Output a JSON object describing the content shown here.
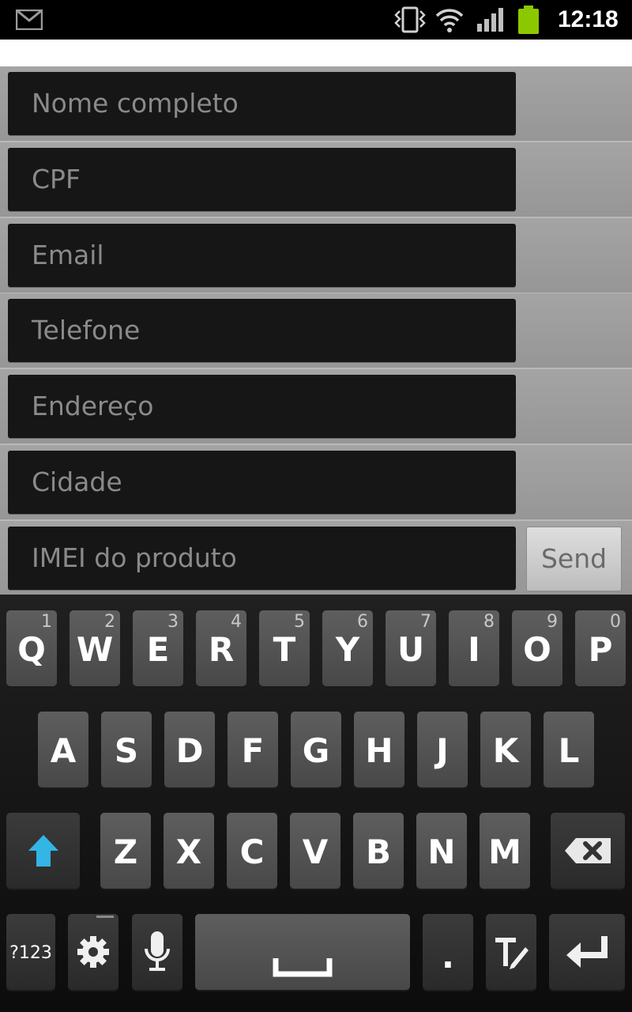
{
  "status_bar": {
    "time": "12:18",
    "icons": [
      "mail-icon",
      "vibrate-icon",
      "wifi-icon",
      "signal-icon",
      "battery-icon"
    ],
    "battery_color": "#8cc800"
  },
  "form": {
    "fields": [
      {
        "placeholder": "Nome completo"
      },
      {
        "placeholder": "CPF"
      },
      {
        "placeholder": "Email"
      },
      {
        "placeholder": "Telefone"
      },
      {
        "placeholder": "Endereço"
      },
      {
        "placeholder": "Cidade"
      },
      {
        "placeholder": "IMEI do produto"
      }
    ],
    "send_label": "Send"
  },
  "keyboard": {
    "row1": [
      {
        "label": "Q",
        "hint": "1"
      },
      {
        "label": "W",
        "hint": "2"
      },
      {
        "label": "E",
        "hint": "3"
      },
      {
        "label": "R",
        "hint": "4"
      },
      {
        "label": "T",
        "hint": "5"
      },
      {
        "label": "Y",
        "hint": "6"
      },
      {
        "label": "U",
        "hint": "7"
      },
      {
        "label": "I",
        "hint": "8"
      },
      {
        "label": "O",
        "hint": "9"
      },
      {
        "label": "P",
        "hint": "0"
      }
    ],
    "row2": [
      {
        "label": "A"
      },
      {
        "label": "S"
      },
      {
        "label": "D"
      },
      {
        "label": "F"
      },
      {
        "label": "G"
      },
      {
        "label": "H"
      },
      {
        "label": "J"
      },
      {
        "label": "K"
      },
      {
        "label": "L"
      }
    ],
    "row3": [
      {
        "label": "Z"
      },
      {
        "label": "X"
      },
      {
        "label": "C"
      },
      {
        "label": "V"
      },
      {
        "label": "B"
      },
      {
        "label": "N"
      },
      {
        "label": "M"
      }
    ],
    "symbols_label": "?123",
    "period_label": ".",
    "shift_color": "#33b5e5",
    "special_icons": [
      "shift-icon",
      "backspace-icon",
      "settings-icon",
      "mic-icon",
      "space-icon",
      "text-edit-icon",
      "enter-icon"
    ]
  }
}
